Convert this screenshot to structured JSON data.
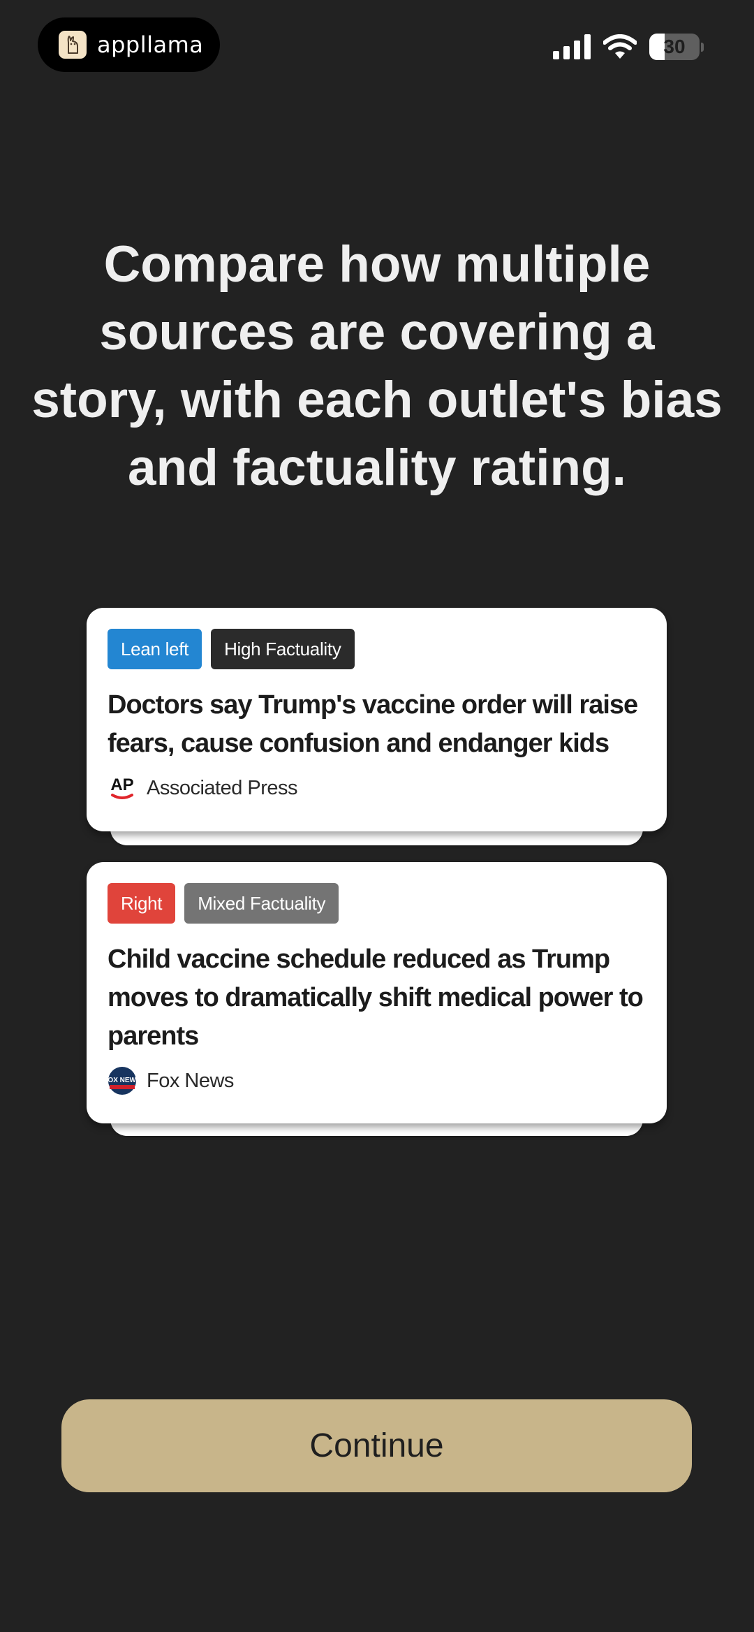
{
  "status_bar": {
    "app_name": "appllama",
    "battery_level": "30",
    "battery_fraction": 0.3
  },
  "headline": "Compare how multiple sources are covering a story, with each outlet's bias and factuality rating.",
  "stories": [
    {
      "bias_label": "Lean left",
      "bias_color": "#2386d2",
      "factuality_label": "High Factuality",
      "factuality_color": "#2b2b2b",
      "title": "Doctors say Trump's vaccine order will raise fears, cause confusion and endanger kids",
      "source": "Associated Press",
      "source_logo_text": "AP",
      "source_icon": "ap-logo-icon"
    },
    {
      "bias_label": "Right",
      "bias_color": "#e0443b",
      "factuality_label": "Mixed Factuality",
      "factuality_color": "#747474",
      "title": "Child vaccine schedule reduced as Trump moves to dramatically shift medical power to parents",
      "source": "Fox News",
      "source_logo_text": "FOX NEWS",
      "source_icon": "fox-news-logo-icon"
    }
  ],
  "continue_label": "Continue",
  "colors": {
    "background": "#222222",
    "continue_button": "#c8b58a"
  }
}
